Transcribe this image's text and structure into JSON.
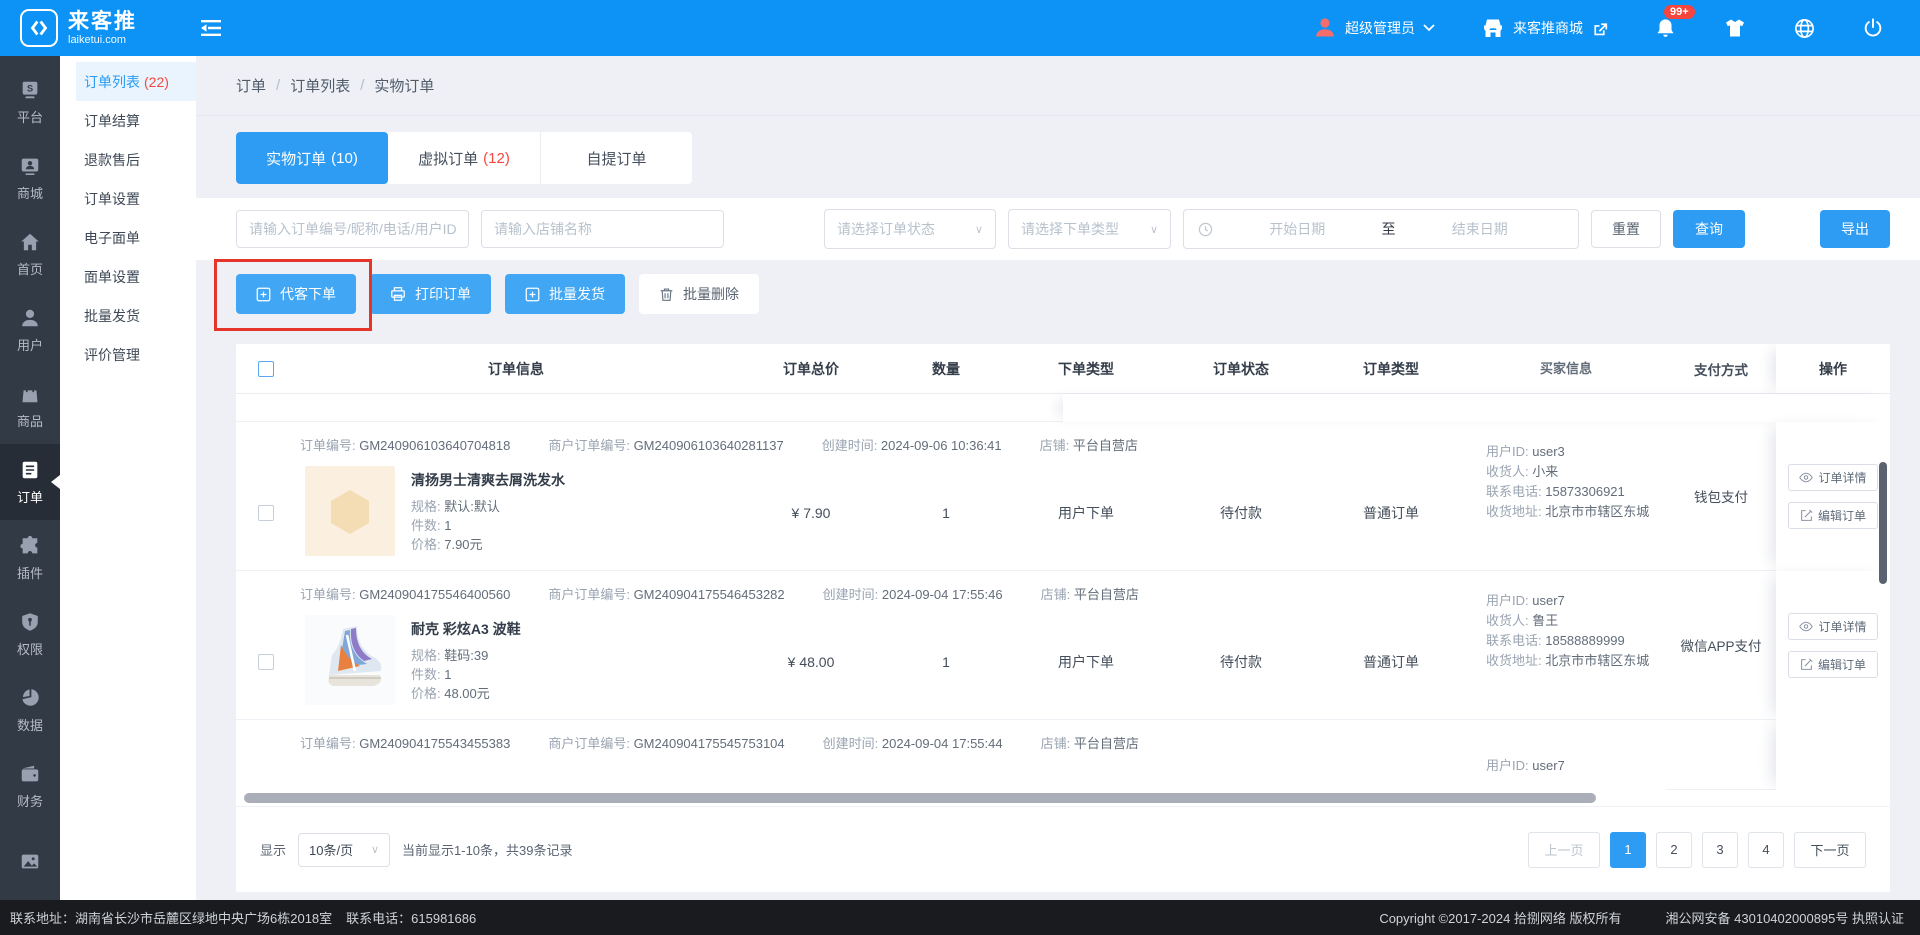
{
  "topbar": {
    "logo_title": "来客推",
    "logo_domain": "laiketui.com",
    "admin_name": "超级管理员",
    "mall_name": "来客推商城",
    "notif_badge": "99+"
  },
  "icon_sidebar": {
    "items": [
      "平台",
      "商城",
      "首页",
      "用户",
      "商品",
      "订单",
      "插件",
      "权限",
      "数据",
      "财务"
    ]
  },
  "sub_sidebar": {
    "items": [
      {
        "label": "订单列表",
        "count": "(22)"
      },
      {
        "label": "订单结算",
        "count": ""
      },
      {
        "label": "退款售后",
        "count": ""
      },
      {
        "label": "订单设置",
        "count": ""
      },
      {
        "label": "电子面单",
        "count": ""
      },
      {
        "label": "面单设置",
        "count": ""
      },
      {
        "label": "批量发货",
        "count": ""
      },
      {
        "label": "评价管理",
        "count": ""
      }
    ]
  },
  "breadcrumb": {
    "sep": "/",
    "parts": [
      "订单",
      "订单列表",
      "实物订单"
    ]
  },
  "tabs": [
    {
      "label": "实物订单",
      "count": "(10)"
    },
    {
      "label": "虚拟订单",
      "count": "(12)"
    },
    {
      "label": "自提订单",
      "count": ""
    }
  ],
  "filters": {
    "keyword_placeholder": "请输入订单编号/昵称/电话/用户ID",
    "shop_placeholder": "请输入店铺名称",
    "status_placeholder": "请选择订单状态",
    "order_type_placeholder": "请选择下单类型",
    "start_date_placeholder": "开始日期",
    "range_separator": "至",
    "end_date_placeholder": "结束日期",
    "reset": "重置",
    "search": "查询",
    "export": "导出"
  },
  "actions": {
    "proxy_order": "代客下单",
    "print_order": "打印订单",
    "batch_ship": "批量发货",
    "batch_delete": "批量删除"
  },
  "table": {
    "headers": {
      "info": "订单信息",
      "total": "订单总价",
      "qty": "数量",
      "mode": "下单类型",
      "status": "订单状态",
      "type": "订单类型",
      "buyer": "买家信息",
      "pay": "支付方式",
      "ops": "操作"
    },
    "labels": {
      "order_no": "订单编号: ",
      "merchant_no": "商户订单编号: ",
      "created": "创建时间: ",
      "shop": "店铺: ",
      "spec": "规格: ",
      "pieces": "件数: ",
      "price": "价格: ",
      "user_id": "用户ID: ",
      "receiver": "收货人: ",
      "phone": "联系电话: ",
      "address": "收货地址: "
    }
  },
  "orders": [
    {
      "order_no": "GM240906103640704818",
      "merchant_no": "GM240906103640281137",
      "created": "2024-09-06 10:36:41",
      "shop": "平台自营店",
      "product_name": "清扬男士清爽去屑洗发水",
      "spec": "默认:默认",
      "pieces": "1",
      "unit_price": "7.90元",
      "total": "¥ 7.90",
      "qty": "1",
      "mode": "用户下单",
      "status": "待付款",
      "type": "普通订单",
      "user_id": "user3",
      "receiver": "小来",
      "phone": "15873306921",
      "address": "北京市市辖区东城",
      "pay": "钱包支付",
      "detail_btn": "订单详情",
      "edit_btn": "编辑订单"
    },
    {
      "order_no": "GM240904175546400560",
      "merchant_no": "GM240904175546453282",
      "created": "2024-09-04 17:55:46",
      "shop": "平台自营店",
      "product_name": "耐克 彩炫A3 波鞋",
      "spec": "鞋码:39",
      "pieces": "1",
      "unit_price": "48.00元",
      "total": "¥ 48.00",
      "qty": "1",
      "mode": "用户下单",
      "status": "待付款",
      "type": "普通订单",
      "user_id": "user7",
      "receiver": "鲁王",
      "phone": "18588889999",
      "address": "北京市市辖区东城",
      "pay": "微信APP支付",
      "detail_btn": "订单详情",
      "edit_btn": "编辑订单"
    },
    {
      "order_no": "GM240904175543455383",
      "merchant_no": "GM240904175545753104",
      "created": "2024-09-04 17:55:44",
      "shop": "平台自营店",
      "user_id": "user7"
    }
  ],
  "pagination": {
    "show_label": "显示",
    "page_size": "10条/页",
    "summary": "当前显示1-10条，共39条记录",
    "prev": "上一页",
    "pages": [
      "1",
      "2",
      "3",
      "4"
    ],
    "next": "下一页"
  },
  "footer": {
    "address": "联系地址：湖南省长沙市岳麓区绿地中央广场6栋2018室",
    "phone": "联系电话：615981686",
    "copyright": "Copyright ©2017-2024 拾捌网络 版权所有",
    "filing": "湘公网安备 43010402000895号 执照认证"
  }
}
